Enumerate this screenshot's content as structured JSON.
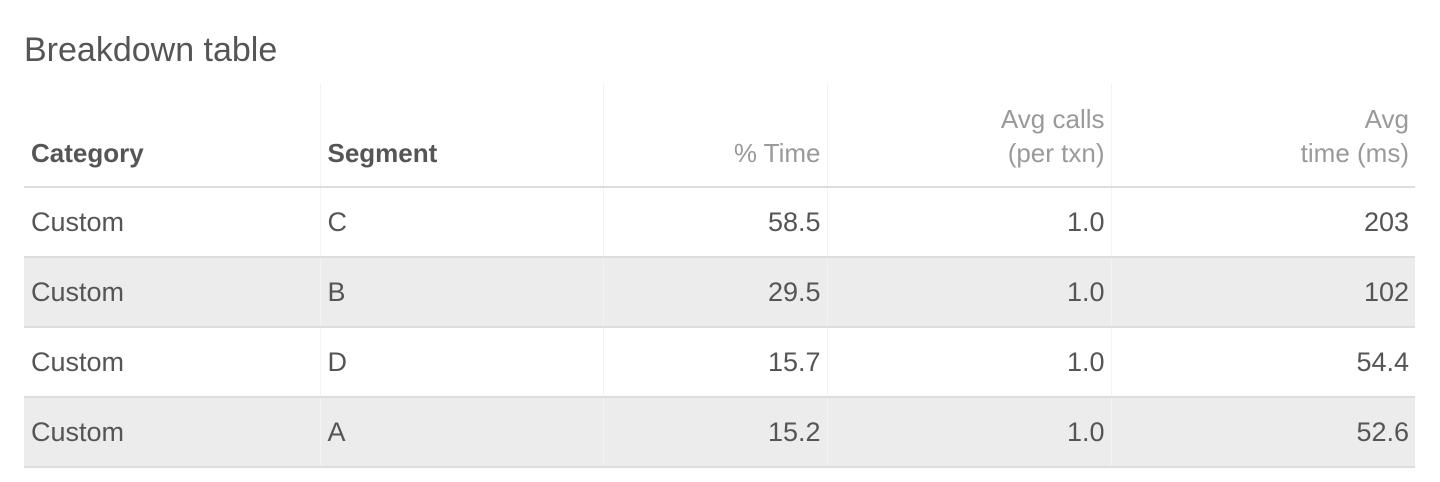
{
  "panel": {
    "title": "Breakdown table"
  },
  "table": {
    "headers": {
      "category": "Category",
      "segment": "Segment",
      "pct_time": "% Time",
      "avg_calls_line1": "Avg calls",
      "avg_calls_line2": "(per txn)",
      "avg_time_line1": "Avg",
      "avg_time_line2": "time (ms)"
    },
    "rows": [
      {
        "category": "Custom",
        "segment": "C",
        "pct_time": "58.5",
        "avg_calls": "1.0",
        "avg_time": "203"
      },
      {
        "category": "Custom",
        "segment": "B",
        "pct_time": "29.5",
        "avg_calls": "1.0",
        "avg_time": "102"
      },
      {
        "category": "Custom",
        "segment": "D",
        "pct_time": "15.7",
        "avg_calls": "1.0",
        "avg_time": "54.4"
      },
      {
        "category": "Custom",
        "segment": "A",
        "pct_time": "15.2",
        "avg_calls": "1.0",
        "avg_time": "52.6"
      }
    ]
  },
  "colors": {
    "text": "#555555",
    "header_muted": "#9a9a9a",
    "stripe": "#ececec",
    "divider": "#dddddd"
  }
}
